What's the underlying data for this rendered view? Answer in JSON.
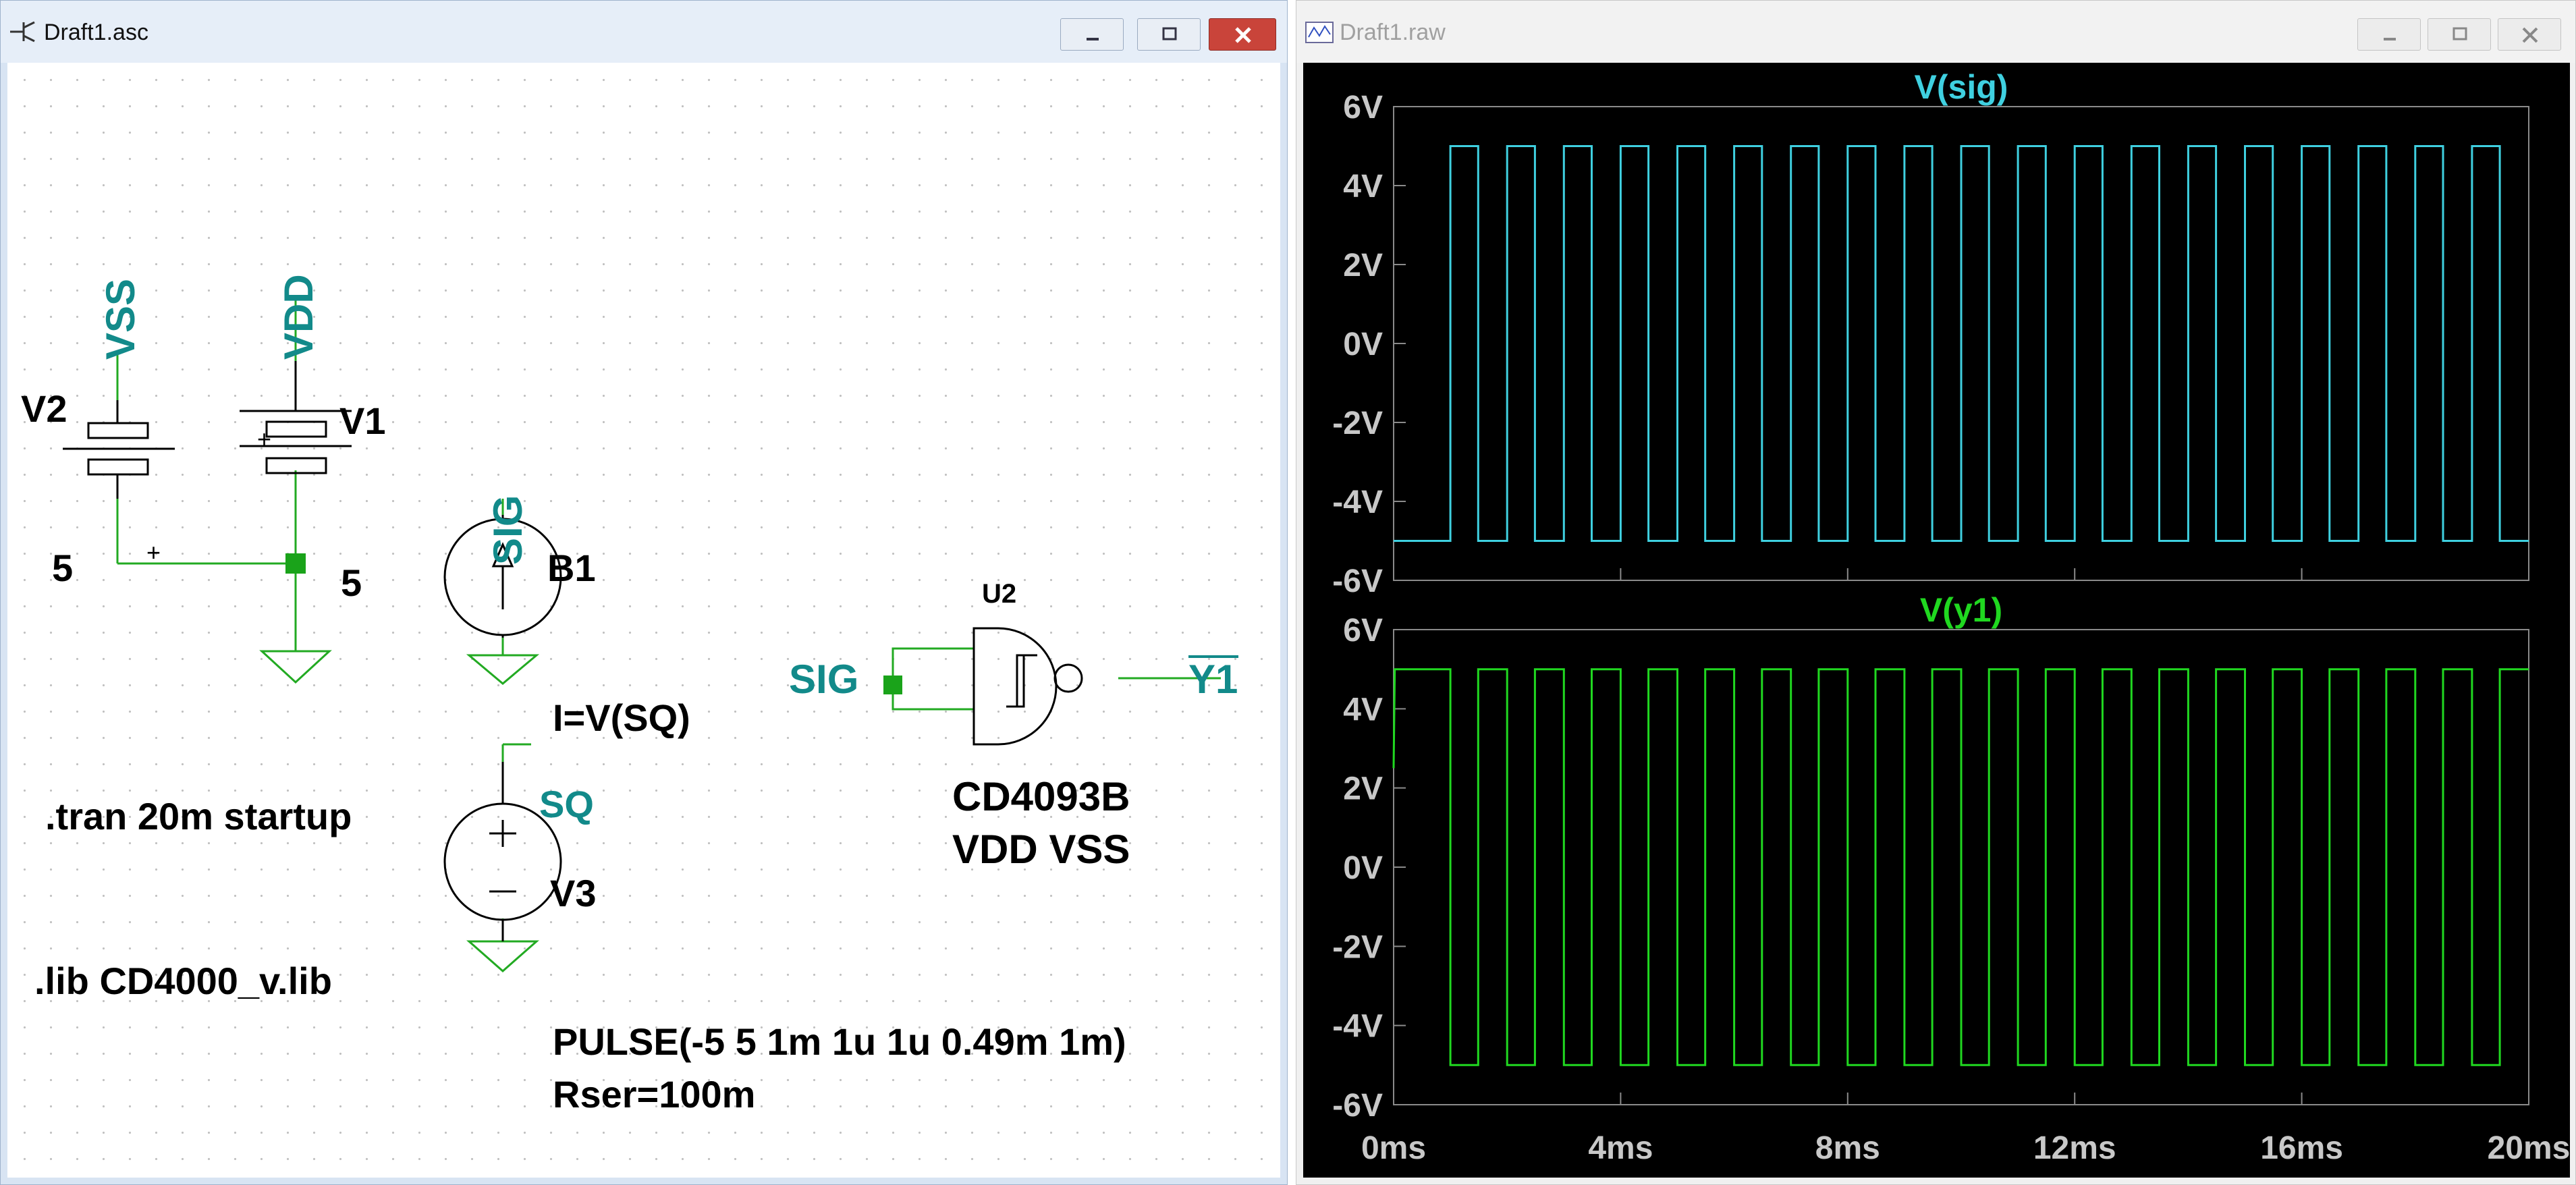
{
  "schematic_window": {
    "title": "Draft1.asc",
    "labels": {
      "vss_net": "VSS",
      "vdd_net": "VDD",
      "v2_name": "V2",
      "v2_value": "5",
      "v1_name": "V1",
      "v1_value": "5",
      "sig_net": "SIG",
      "b1_name": "B1",
      "b1_value": "I=V(SQ)",
      "sq_net": "SQ",
      "v3_name": "V3",
      "v3_value": "PULSE(-5 5 1m 1u 1u 0.49m 1m)",
      "v3_rser": "Rser=100m",
      "tran_directive": ".tran 20m startup",
      "lib_directive": ".lib CD4000_v.lib",
      "u2_name": "U2",
      "u2_input_net": "SIG",
      "u2_output_net": "Y1",
      "u2_part": "CD4093B",
      "u2_pins": "VDD VSS",
      "plus_sign": "+"
    }
  },
  "plot_window": {
    "title": "Draft1.raw",
    "colors": {
      "sig": "#3fd0e0",
      "y1": "#20d820",
      "grid": "#8a8a8a",
      "axis_text": "#c8c8c8"
    }
  },
  "chart_data": [
    {
      "type": "line",
      "title": "V(sig)",
      "x_ticks": [
        "0ms",
        "4ms",
        "8ms",
        "12ms",
        "16ms",
        "20ms"
      ],
      "y_ticks": [
        "6V",
        "4V",
        "2V",
        "0V",
        "-2V",
        "-4V",
        "-6V"
      ],
      "xlim": [
        0,
        20
      ],
      "ylim": [
        -6,
        6
      ],
      "x_unit": "ms",
      "series": [
        {
          "pulse": {
            "low": -5,
            "high": 5,
            "delay": 1,
            "width": 0.49,
            "period": 1,
            "cycles": 19
          }
        }
      ]
    },
    {
      "type": "line",
      "title": "V(y1)",
      "x_ticks": [
        "0ms",
        "4ms",
        "8ms",
        "12ms",
        "16ms",
        "20ms"
      ],
      "y_ticks": [
        "6V",
        "4V",
        "2V",
        "0V",
        "-2V",
        "-4V",
        "-6V"
      ],
      "xlim": [
        0,
        20
      ],
      "ylim": [
        -6,
        6
      ],
      "x_unit": "ms",
      "series": [
        {
          "start": 2.5,
          "pulse": {
            "low": 5,
            "high": -5,
            "delay": 1,
            "width": 0.49,
            "period": 1,
            "cycles": 19
          }
        }
      ]
    }
  ]
}
